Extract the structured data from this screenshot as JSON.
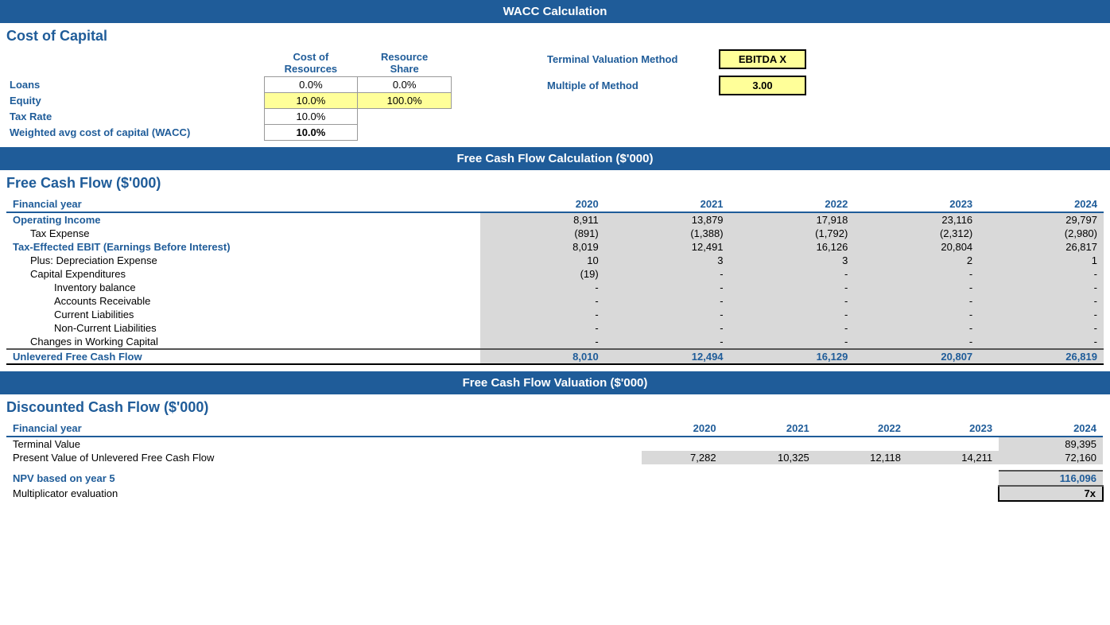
{
  "header": {
    "title": "WACC Calculation"
  },
  "cost_of_capital": {
    "section_title": "Cost of Capital",
    "col_headers": {
      "cost_of_resources": "Cost of Resources",
      "resource_share": "Resource Share"
    },
    "rows": [
      {
        "label": "Loans",
        "cost": "0.0%",
        "share": "0.0%",
        "cost_bg": "white",
        "share_bg": "white"
      },
      {
        "label": "Equity",
        "cost": "10.0%",
        "share": "100.0%",
        "cost_bg": "yellow",
        "share_bg": "yellow"
      },
      {
        "label": "Tax Rate",
        "cost": "10.0%",
        "share": "",
        "cost_bg": "white",
        "share_bg": ""
      },
      {
        "label": "Weighted avg cost of capital (WACC)",
        "cost": "10.0%",
        "share": "",
        "cost_bg": "white",
        "share_bg": ""
      }
    ],
    "terminal": {
      "method_label": "Terminal Valuation Method",
      "method_value": "EBITDA X",
      "multiple_label": "Multiple of Method",
      "multiple_value": "3.00"
    }
  },
  "fcf_header": "Free Cash Flow Calculation ($'000)",
  "fcf": {
    "section_title": "Free Cash Flow ($'000)",
    "col_headers": [
      "Financial year",
      "2020",
      "2021",
      "2022",
      "2023",
      "2024"
    ],
    "rows": [
      {
        "type": "bold-blue",
        "indent": 0,
        "label": "Financial year",
        "values": [
          "",
          "",
          "",
          "",
          ""
        ]
      },
      {
        "type": "bold-blue",
        "indent": 0,
        "label": "Operating Income",
        "values": [
          "8,911",
          "13,879",
          "17,918",
          "23,116",
          "29,797"
        ]
      },
      {
        "type": "normal",
        "indent": 1,
        "label": "Tax Expense",
        "values": [
          "(891)",
          "(1,388)",
          "(1,792)",
          "(2,312)",
          "(2,980)"
        ]
      },
      {
        "type": "bold-blue",
        "indent": 0,
        "label": "Tax-Effected EBIT (Earnings Before Interest)",
        "values": [
          "8,019",
          "12,491",
          "16,126",
          "20,804",
          "26,817"
        ]
      },
      {
        "type": "normal",
        "indent": 1,
        "label": "Plus: Depreciation Expense",
        "values": [
          "10",
          "3",
          "3",
          "2",
          "1"
        ]
      },
      {
        "type": "normal",
        "indent": 1,
        "label": "Capital Expenditures",
        "values": [
          "(19)",
          "-",
          "-",
          "-",
          "-"
        ]
      },
      {
        "type": "normal",
        "indent": 2,
        "label": "Inventory balance",
        "values": [
          "-",
          "-",
          "-",
          "-",
          "-"
        ]
      },
      {
        "type": "normal",
        "indent": 2,
        "label": "Accounts Receivable",
        "values": [
          "-",
          "-",
          "-",
          "-",
          "-"
        ]
      },
      {
        "type": "normal",
        "indent": 2,
        "label": "Current Liabilities",
        "values": [
          "-",
          "-",
          "-",
          "-",
          "-"
        ]
      },
      {
        "type": "normal",
        "indent": 2,
        "label": "Non-Current Liabilities",
        "values": [
          "-",
          "-",
          "-",
          "-",
          "-"
        ]
      },
      {
        "type": "normal-bottom",
        "indent": 1,
        "label": "Changes in Working Capital",
        "values": [
          "-",
          "-",
          "-",
          "-",
          "-"
        ]
      },
      {
        "type": "total",
        "indent": 0,
        "label": "Unlevered Free Cash Flow",
        "values": [
          "8,010",
          "12,494",
          "16,129",
          "20,807",
          "26,819"
        ]
      }
    ]
  },
  "fcf_val_header": "Free Cash Flow Valuation ($'000)",
  "dcf": {
    "section_title": "Discounted Cash Flow ($'000)",
    "col_headers": [
      "Financial year",
      "2020",
      "2021",
      "2022",
      "2023",
      "2024"
    ],
    "rows": [
      {
        "type": "header-row",
        "label": "Financial year",
        "values": [
          "2020",
          "2021",
          "2022",
          "2023",
          "2024"
        ]
      },
      {
        "type": "normal",
        "label": "Terminal Value",
        "values": [
          "",
          "",
          "",
          "",
          "89,395"
        ]
      },
      {
        "type": "normal",
        "label": "Present Value of Unlevered Free Cash Flow",
        "values": [
          "7,282",
          "10,325",
          "12,118",
          "14,211",
          "72,160"
        ]
      },
      {
        "type": "spacer"
      },
      {
        "type": "npv",
        "label": "NPV based on year 5",
        "values": [
          "",
          "",
          "",
          "",
          "116,096"
        ]
      },
      {
        "type": "multiplicator",
        "label": "Multiplicator evaluation",
        "values": [
          "",
          "",
          "",
          "",
          "7x"
        ]
      }
    ]
  }
}
